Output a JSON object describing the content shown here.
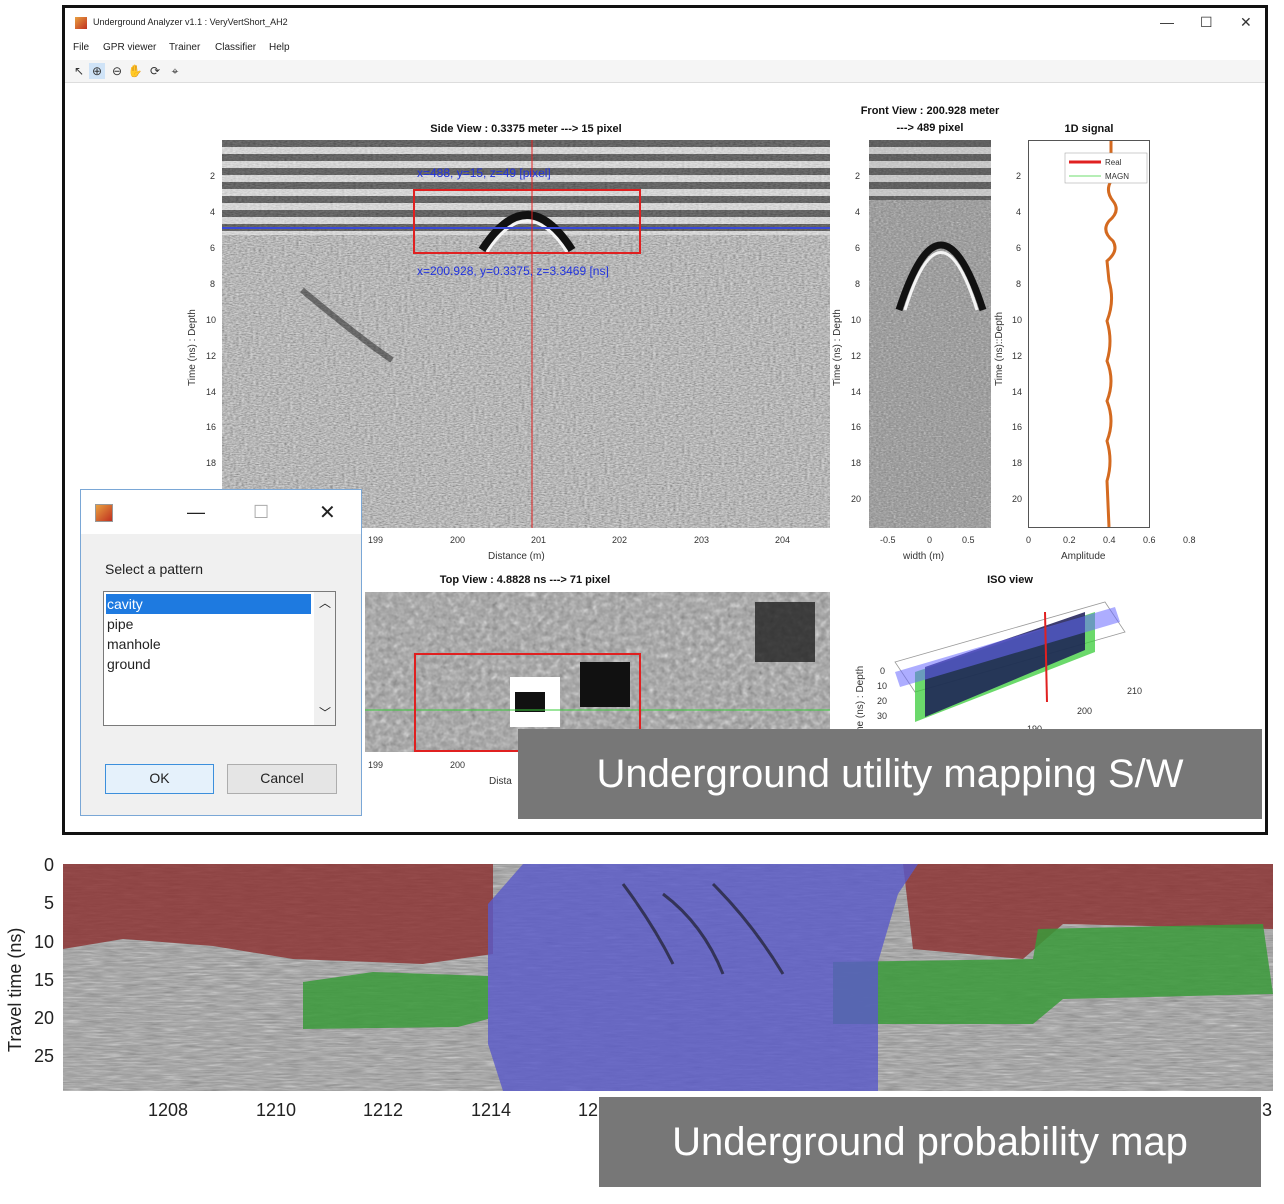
{
  "window": {
    "title": "Underground Analyzer v1.1 : VeryVertShort_AH2",
    "controls": {
      "minimize": "—",
      "maximize": "☐",
      "close": "✕"
    }
  },
  "menu": [
    "File",
    "GPR viewer",
    "Trainer",
    "Classifier",
    "Help"
  ],
  "toolbar_icons": [
    "pointer-icon",
    "zoom-in-icon",
    "zoom-out-icon",
    "pan-icon",
    "rotate-icon",
    "data-cursor-icon"
  ],
  "side_view": {
    "title": "Side View : 0.3375 meter ---> 15 pixel",
    "ylabel": "Time (ns) : Depth",
    "xlabel": "Distance (m)",
    "yticks": [
      "2",
      "4",
      "6",
      "8",
      "10",
      "12",
      "14",
      "16",
      "18"
    ],
    "xticks": [
      "199",
      "200",
      "201",
      "202",
      "203",
      "204"
    ],
    "annot_top": "x=488, y=15, z=49 [pixel]",
    "annot_bottom": "x=200.928, y=0.3375, z=3.3469 [ns]"
  },
  "front_view": {
    "title_line1": "Front View : 200.928 meter",
    "title_line2": "---> 489 pixel",
    "ylabel": "Time (ns) : Depth",
    "xlabel": "width (m)",
    "yticks": [
      "2",
      "4",
      "6",
      "8",
      "10",
      "12",
      "14",
      "16",
      "18",
      "20"
    ],
    "xticks": [
      "-0.5",
      "0",
      "0.5"
    ]
  },
  "signal_1d": {
    "title": "1D signal",
    "ylabel": "Time (ns)::Depth",
    "xlabel": "Amplitude",
    "yticks": [
      "2",
      "4",
      "6",
      "8",
      "10",
      "12",
      "14",
      "16",
      "18",
      "20"
    ],
    "xticks": [
      "0",
      "0.2",
      "0.4",
      "0.6",
      "0.8"
    ],
    "legend": [
      {
        "name": "Real",
        "color": "#e02020"
      },
      {
        "name": "MAGN",
        "color": "#6ddc6d"
      }
    ]
  },
  "top_view": {
    "title": "Top View : 4.8828 ns ---> 71 pixel",
    "xlabel": "Dista",
    "xticks": [
      "199",
      "200"
    ]
  },
  "iso_view": {
    "title": "ISO view",
    "ylabel": "ne (ns) : Depth",
    "zticks": [
      "0",
      "10",
      "20",
      "30"
    ],
    "xticks": [
      "210",
      "200",
      "190"
    ]
  },
  "dialog": {
    "prompt": "Select a pattern",
    "options": [
      "cavity",
      "pipe",
      "manhole",
      "ground"
    ],
    "selected": "cavity",
    "ok_label": "OK",
    "cancel_label": "Cancel",
    "controls": {
      "minimize": "—",
      "maximize": "☐",
      "close": "✕"
    }
  },
  "caption_top": "Underground utility mapping S/W",
  "prob_map": {
    "ylabel": "Travel time (ns)",
    "yticks": [
      "0",
      "5",
      "10",
      "15",
      "20",
      "25"
    ],
    "xticks": [
      "1208",
      "1210",
      "1212",
      "1214",
      "12"
    ],
    "x_right_tick": "3",
    "class_colors": {
      "red": "#8b2e2e",
      "blue": "#5a5ac8",
      "green": "#3a9a3a"
    }
  },
  "caption_bottom": "Underground probability map"
}
